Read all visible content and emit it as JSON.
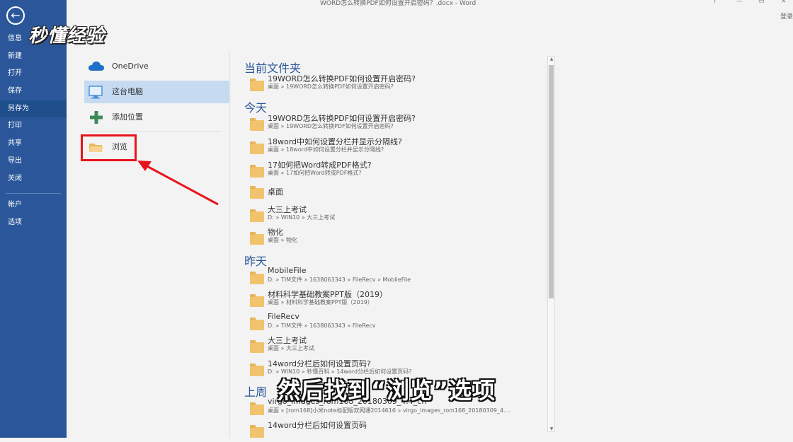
{
  "window": {
    "title": "WORD怎么转换PDF如何设置开启密码？.docx - Word",
    "help": "?",
    "min": "—",
    "restore": "▭",
    "close": "✕",
    "login": "登录"
  },
  "logo": "秒懂经验",
  "sidebar": {
    "back_icon": "←",
    "items": [
      {
        "label": "信息"
      },
      {
        "label": "新建"
      },
      {
        "label": "打开"
      },
      {
        "label": "保存"
      },
      {
        "label": "另存为"
      },
      {
        "label": "打印"
      },
      {
        "label": "共享"
      },
      {
        "label": "导出"
      },
      {
        "label": "关闭"
      },
      {
        "label": "帐户"
      },
      {
        "label": "选项"
      }
    ]
  },
  "locations": [
    {
      "label": "OneDrive",
      "icon": "cloud-icon"
    },
    {
      "label": "这台电脑",
      "icon": "computer-icon"
    },
    {
      "label": "添加位置",
      "icon": "plus-icon"
    },
    {
      "label": "浏览",
      "icon": "folder-icon"
    }
  ],
  "sections": {
    "current": "当前文件夹",
    "today": "今天",
    "yesterday": "昨天",
    "lastweek": "上周"
  },
  "folders": [
    {
      "name": "19WORD怎么转换PDF如何设置开启密码?",
      "path": "桌面 » 19WORD怎么转换PDF如何设置开启密码?"
    },
    {
      "name": "19WORD怎么转换PDF如何设置开启密码?",
      "path": "桌面 » 19WORD怎么转换PDF如何设置开启密码?"
    },
    {
      "name": "18word中如何设置分栏并显示分隔线?",
      "path": "桌面 » 18word中如何设置分栏并显示分隔线?"
    },
    {
      "name": "17如何把Word转成PDF格式?",
      "path": "桌面 » 17如何把Word转成PDF格式?"
    },
    {
      "name": "桌面",
      "path": ""
    },
    {
      "name": "大三上考试",
      "path": "D: » WIN10 » 大三上考试"
    },
    {
      "name": "物化",
      "path": "桌面 » 物化"
    },
    {
      "name": "MobileFile",
      "path": "D: » TIM文件 » 1638063343 » FileRecv » MobileFile"
    },
    {
      "name": "材料科学基础教案PPT版（2019）",
      "path": "桌面 » 材料科学基础教案PPT版（2019）"
    },
    {
      "name": "FileRecv",
      "path": "D: » TIM文件 » 1638063343 » FileRecv"
    },
    {
      "name": "大三上考试",
      "path": "桌面 » 大三上考试"
    },
    {
      "name": "14word分栏后如何设置页码?",
      "path": "D: » WIN10 » 秒懂百科 » 14word分栏后如何设置页码?"
    },
    {
      "name": "virgo_images_rom168_20180309_4.4_cn",
      "path": "桌面 » [rom168]小米note标配版双网通2014616 » virgo_images_rom168_20180309_4...."
    },
    {
      "name": "14word分栏后如何设置页码",
      "path": ""
    }
  ],
  "subtitle": "然后找到“浏览”选项",
  "colors": {
    "sidebar": "#2b579a",
    "accent": "#2b579a",
    "selected": "#c6dbf2",
    "highlight_box": "#e8141b"
  }
}
